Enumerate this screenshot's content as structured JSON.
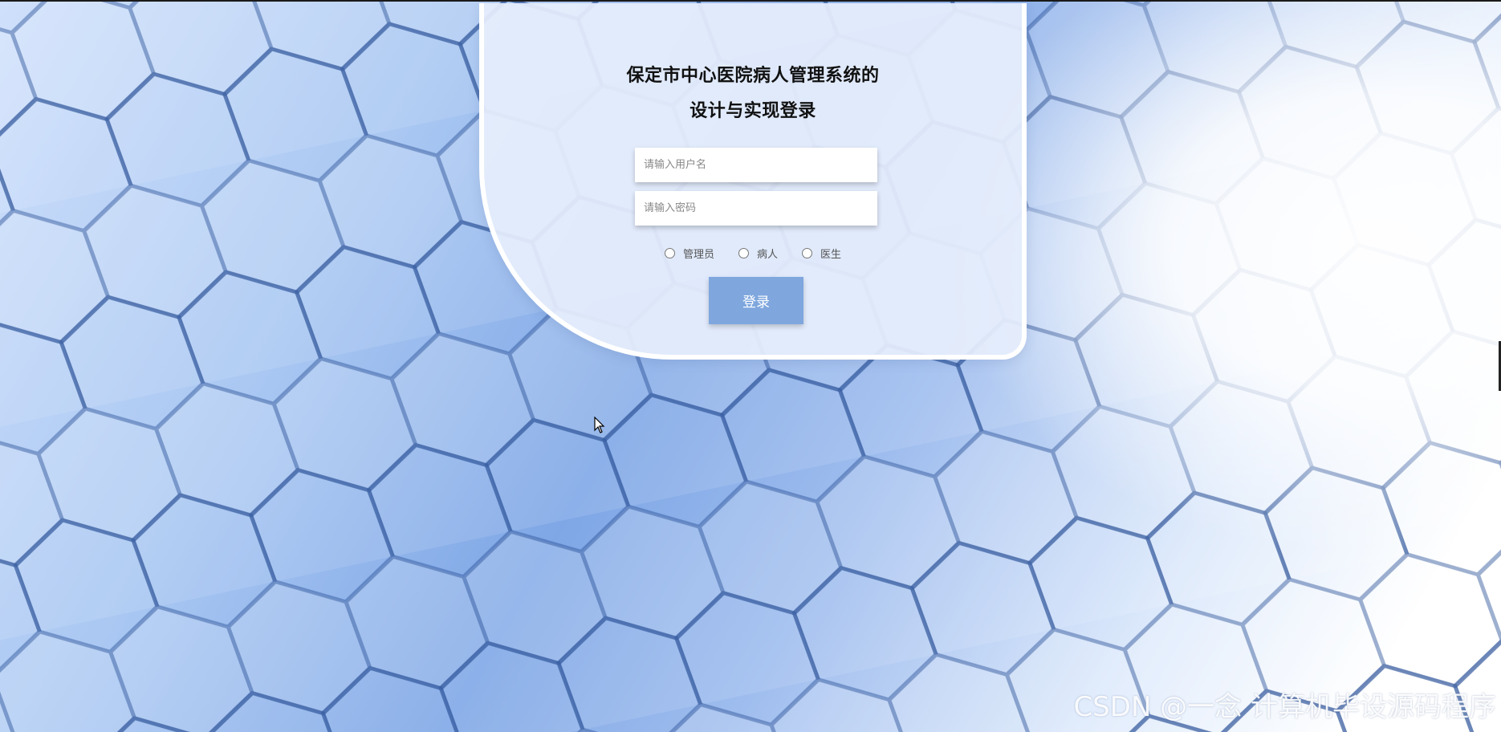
{
  "login": {
    "title_line1": "保定市中心医院病人管理系统的",
    "title_line2": "设计与实现登录",
    "username_placeholder": "请输入用户名",
    "password_placeholder": "请输入密码",
    "roles": [
      "管理员",
      "病人",
      "医生"
    ],
    "submit_label": "登录",
    "button_color": "#7fa7de"
  },
  "watermark": "CSDN @一念 计算机毕设源码程序"
}
